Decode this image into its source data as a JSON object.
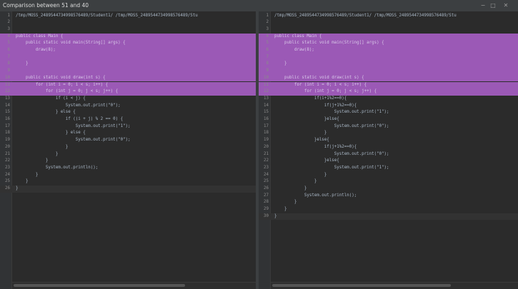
{
  "window": {
    "title": "Comparison between 51 and 40",
    "minimize_glyph": "−",
    "maximize_glyph": "□",
    "close_glyph": "✕"
  },
  "left_pane": {
    "highlight_color": "#9b59b6",
    "lines": [
      {
        "n": "1",
        "text": "/tmp/MOSS_2489544734998576489/Student1/ /tmp/MOSS_2489544734998576489/Stu"
      },
      {
        "n": "2",
        "text": ""
      },
      {
        "n": "3",
        "text": ""
      },
      {
        "n": "4",
        "text": "public class Main {"
      },
      {
        "n": "5",
        "text": "    public static void main(String[] args) {"
      },
      {
        "n": "6",
        "text": "        draw(8);"
      },
      {
        "n": "7",
        "text": ""
      },
      {
        "n": "8",
        "text": "    }"
      },
      {
        "n": "9",
        "text": ""
      },
      {
        "n": "10",
        "text": "    public static void draw(int s) {"
      },
      {
        "n": "11",
        "text": "        for (int i = 0; i < s; i++) {"
      },
      {
        "n": "12",
        "text": "            for (int j = 0; j < s; j++) {"
      },
      {
        "n": "13",
        "text": "                if (i < j) {"
      },
      {
        "n": "14",
        "text": "                    System.out.print(\"0\");"
      },
      {
        "n": "15",
        "text": "                } else {"
      },
      {
        "n": "16",
        "text": "                    if ((i + j) % 2 == 0) {"
      },
      {
        "n": "17",
        "text": "                        System.out.print(\"1\");"
      },
      {
        "n": "18",
        "text": "                    } else {"
      },
      {
        "n": "19",
        "text": "                        System.out.print(\"0\");"
      },
      {
        "n": "20",
        "text": "                    }"
      },
      {
        "n": "21",
        "text": "                }"
      },
      {
        "n": "22",
        "text": "            }"
      },
      {
        "n": "23",
        "text": "            System.out.println();"
      },
      {
        "n": "24",
        "text": "        }"
      },
      {
        "n": "25",
        "text": "    }"
      },
      {
        "n": "26",
        "text": "}"
      }
    ]
  },
  "right_pane": {
    "highlight_color": "#9b59b6",
    "lines": [
      {
        "n": "1",
        "text": "/tmp/MOSS_2489544734998576489/Student1/ /tmp/MOSS_2489544734998576489/Stu"
      },
      {
        "n": "2",
        "text": ""
      },
      {
        "n": "3",
        "text": ""
      },
      {
        "n": "4",
        "text": "public class Main {"
      },
      {
        "n": "5",
        "text": "    public static void main(String[] args) {"
      },
      {
        "n": "6",
        "text": "        draw(8);"
      },
      {
        "n": "7",
        "text": ""
      },
      {
        "n": "8",
        "text": "    }"
      },
      {
        "n": "9",
        "text": ""
      },
      {
        "n": "10",
        "text": "    public static void draw(int s) {"
      },
      {
        "n": "11",
        "text": "        for (int i = 0; i < s; i++) {"
      },
      {
        "n": "12",
        "text": "            for (int j = 0; j < s; j++) {"
      },
      {
        "n": "13",
        "text": "                if(i+1%2==0){"
      },
      {
        "n": "14",
        "text": "                    if(j+1%2==0){"
      },
      {
        "n": "15",
        "text": "                        System.out.print(\"1\");"
      },
      {
        "n": "16",
        "text": "                    }else{"
      },
      {
        "n": "17",
        "text": "                        System.out.print(\"0\");"
      },
      {
        "n": "18",
        "text": "                    }"
      },
      {
        "n": "19",
        "text": "                }else{"
      },
      {
        "n": "20",
        "text": "                    if(j+1%2==0){"
      },
      {
        "n": "21",
        "text": "                        System.out.print(\"0\");"
      },
      {
        "n": "22",
        "text": "                    }else{"
      },
      {
        "n": "23",
        "text": "                        System.out.print(\"1\");"
      },
      {
        "n": "24",
        "text": "                    }"
      },
      {
        "n": "25",
        "text": "                }"
      },
      {
        "n": "26",
        "text": "            }"
      },
      {
        "n": "27",
        "text": "            System.out.println();"
      },
      {
        "n": "28",
        "text": "        }"
      },
      {
        "n": "29",
        "text": "    }"
      },
      {
        "n": "30",
        "text": "}"
      }
    ]
  }
}
